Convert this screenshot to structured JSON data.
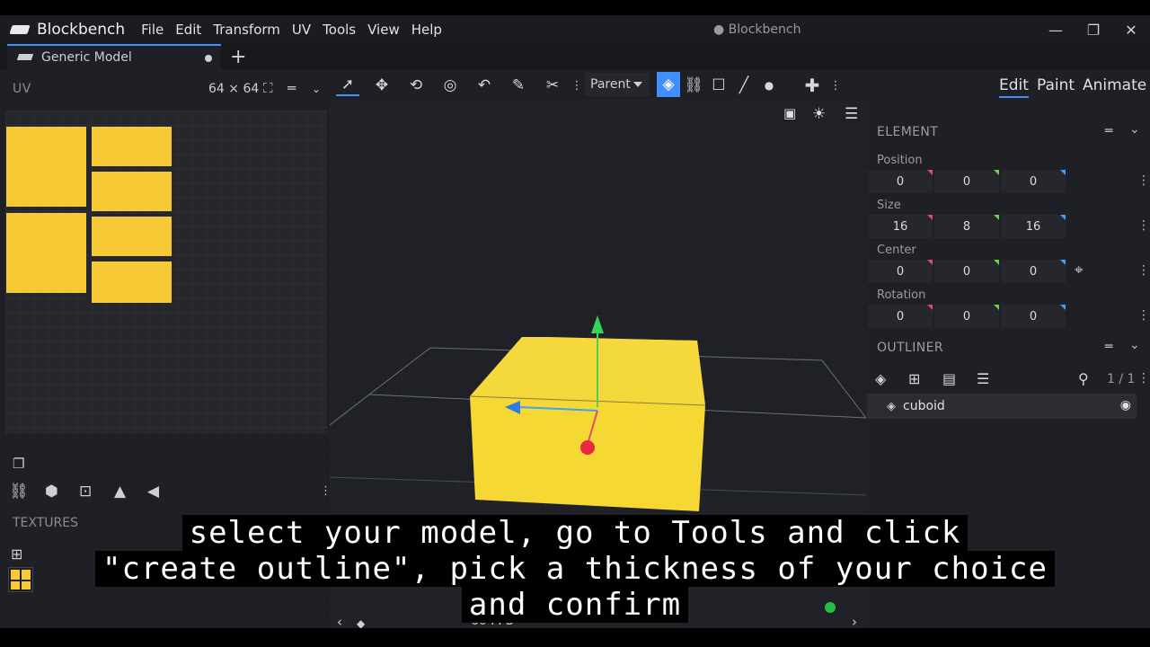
{
  "app": {
    "name": "Blockbench",
    "window_title": "● Blockbench",
    "menu": [
      "File",
      "Edit",
      "Transform",
      "UV",
      "Tools",
      "View",
      "Help"
    ],
    "window_buttons": [
      "—",
      "❐",
      "✕"
    ]
  },
  "tabs": [
    {
      "label": "Generic Model",
      "unsaved": true
    }
  ],
  "uv_panel": {
    "title": "UV",
    "texture_size": "64 × 64"
  },
  "textures_panel": {
    "title": "TEXTURES"
  },
  "toolbar": {
    "pivot_mode": "Parent"
  },
  "viewport": {
    "fps": "60 FPS"
  },
  "right_panel": {
    "modes": [
      "Edit",
      "Paint",
      "Animate"
    ],
    "active_mode": "Edit",
    "element": {
      "title": "ELEMENT",
      "position": {
        "label": "Position",
        "values": [
          "0",
          "0",
          "0"
        ]
      },
      "size": {
        "label": "Size",
        "values": [
          "16",
          "8",
          "16"
        ]
      },
      "center": {
        "label": "Center",
        "values": [
          "0",
          "0",
          "0"
        ]
      },
      "rotation": {
        "label": "Rotation",
        "values": [
          "0",
          "0",
          "0"
        ]
      }
    },
    "outliner": {
      "title": "OUTLINER",
      "count": "1 / 1",
      "items": [
        {
          "name": "cuboid",
          "visible": true
        }
      ]
    }
  },
  "subtitle": {
    "lines": [
      "select your model, go to Tools and click",
      "\"create outline\", pick a thickness of your choice",
      "and confirm"
    ]
  },
  "colors": {
    "accent": "#3e90ff",
    "texture_yellow": "#f7c934",
    "axis_x": "#e84a6a",
    "axis_y": "#6bd24a",
    "axis_z": "#3ea0ff"
  }
}
